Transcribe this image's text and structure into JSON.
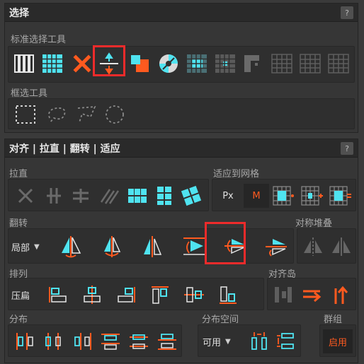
{
  "select_panel": {
    "title": "选择",
    "help": "?",
    "standard_tools_label": "标准选择工具",
    "marquee_tools_label": "框选工具"
  },
  "align_panel": {
    "title": "对齐 | 拉直 | 翻转 | 适应",
    "help": "?",
    "straighten_label": "拉直",
    "fit_grid_label": "适应到网格",
    "fit_px": "Px",
    "fit_m": "M",
    "flip_label": "翻转",
    "flip_mode": "局部",
    "sym_stack_label": "对称堆叠",
    "arrange_label": "排列",
    "arrange_compress": "压扁",
    "align_island_label": "对齐岛",
    "distribute_label": "分布",
    "distribute_space_label": "分布空间",
    "distribute_space_value": "可用",
    "group_label": "群组",
    "group_enable": "启用"
  },
  "colors": {
    "accent_cyan": "#4fe3f0",
    "accent_orange": "#ff5a1f",
    "highlight_red": "#ee2b2b",
    "panel_bg": "#363636",
    "header_bg": "#2a2a2a"
  }
}
